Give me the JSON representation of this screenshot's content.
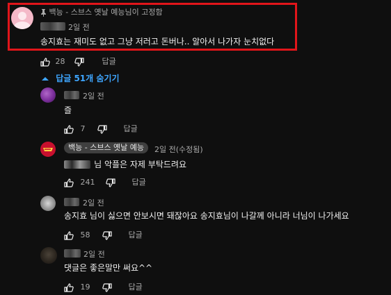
{
  "pinned": {
    "pinned_by": "백능 - 스브스 옛날 예능님이 고정함",
    "time": "2일 전",
    "text": "송지효는 재미도 없고 그냥 저러고 돈버나.. 알아서 나가자 눈치없다",
    "likes": "28",
    "reply_label": "답글"
  },
  "replies_toggle": {
    "label": "답글 51개 숨기기"
  },
  "replies": [
    {
      "time": "2일 전",
      "text": "즐",
      "likes": "7",
      "reply_label": "답글"
    },
    {
      "channel": "백능 - 스브스 옛날 예능",
      "time": "2일 전(수정됨)",
      "text": "님 악플은 자제 부탁드려요",
      "likes": "241",
      "reply_label": "답글"
    },
    {
      "time": "2일 전",
      "text": "송지효 님이 싫으면 안보시면 돼잖아요 송지효님이 나갈께 아니라 너님이 나가세요",
      "likes": "58",
      "reply_label": "답글"
    },
    {
      "time": "2일 전",
      "text": "댓글은 좋은말만 써요^^",
      "likes": "19",
      "reply_label": "답글"
    }
  ],
  "colors": {
    "highlight": "#e1151a",
    "link": "#3ea6ff",
    "background": "#0f0f0f"
  },
  "icons": [
    "pin-icon",
    "thumb-up-icon",
    "thumb-down-icon",
    "chevron-up-icon"
  ]
}
